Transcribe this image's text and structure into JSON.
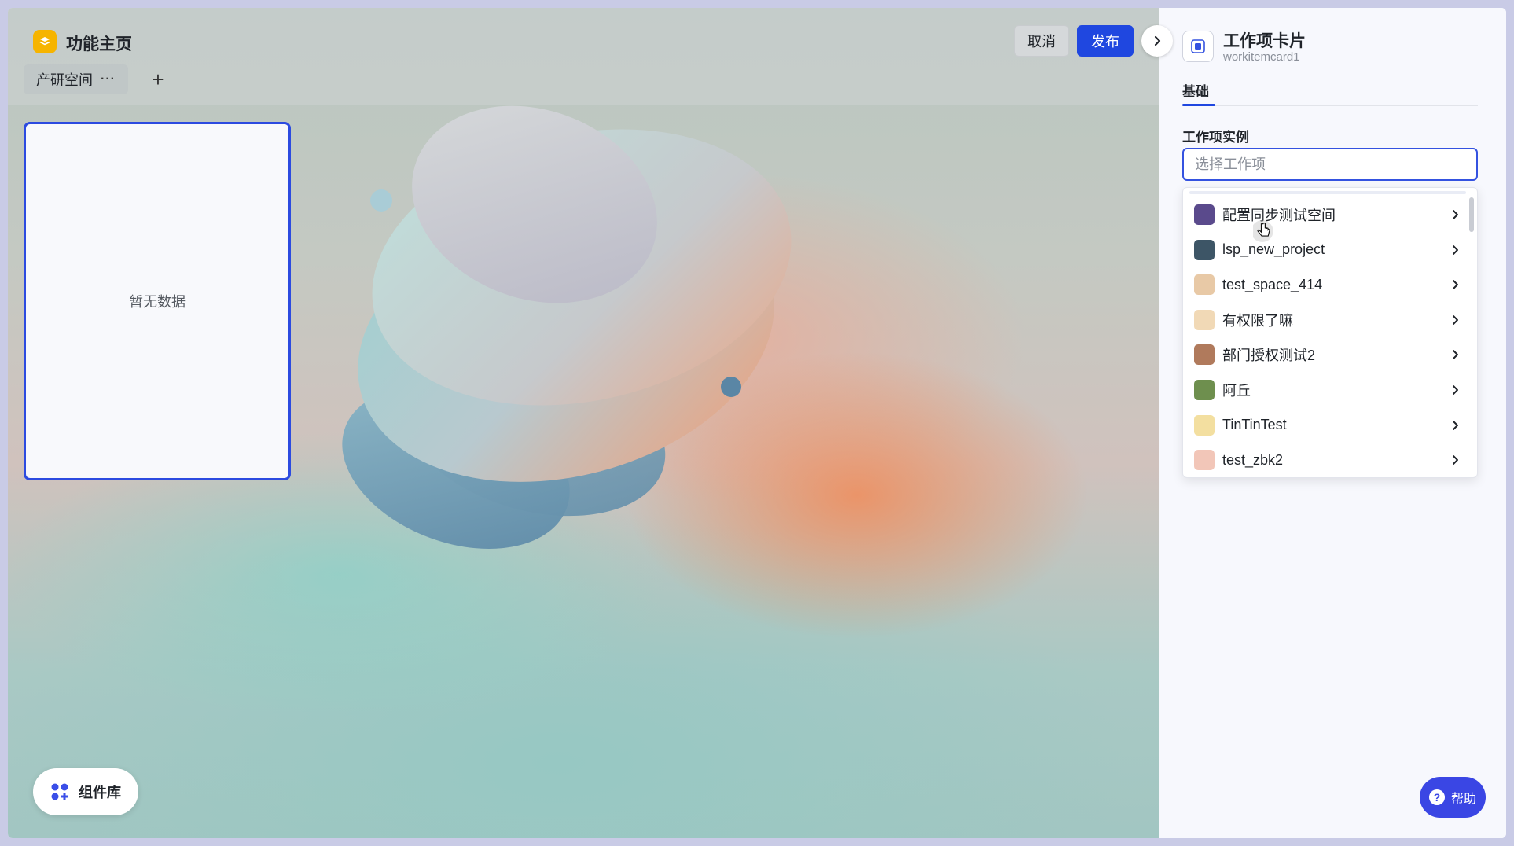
{
  "app": {
    "title": "功能主页"
  },
  "workspace_tabs": [
    {
      "label": "产研空间",
      "more": "···"
    }
  ],
  "add_tab": "+",
  "toolbar": {
    "cancel_label": "取消",
    "publish_label": "发布"
  },
  "canvas": {
    "empty_text": "暂无数据"
  },
  "component_library": {
    "label": "组件库"
  },
  "panel": {
    "component_title": "工作项卡片",
    "component_id": "workitemcard1",
    "tabs": [
      {
        "label": "基础",
        "active": true
      }
    ],
    "field_label": "工作项实例",
    "select_placeholder": "选择工作项",
    "options": [
      {
        "label": "配置同步测试空间",
        "avatar_color": "#5a4a8c"
      },
      {
        "label": "lsp_new_project",
        "avatar_color": "#3d5566"
      },
      {
        "label": "test_space_414",
        "avatar_color": "#e8c9a6"
      },
      {
        "label": "有权限了嘛",
        "avatar_color": "#f1d9b6"
      },
      {
        "label": "部门授权测试2",
        "avatar_color": "#b07a5c"
      },
      {
        "label": "阿丘",
        "avatar_color": "#6e8f4e"
      },
      {
        "label": "TinTinTest",
        "avatar_color": "#f3dfa0"
      },
      {
        "label": "test_zbk2",
        "avatar_color": "#f2c6b8"
      }
    ]
  },
  "help": {
    "label": "帮助",
    "icon": "?"
  },
  "colors": {
    "accent": "#1f47e0",
    "help": "#3a46e4",
    "brand_logo": "#f6b400"
  }
}
